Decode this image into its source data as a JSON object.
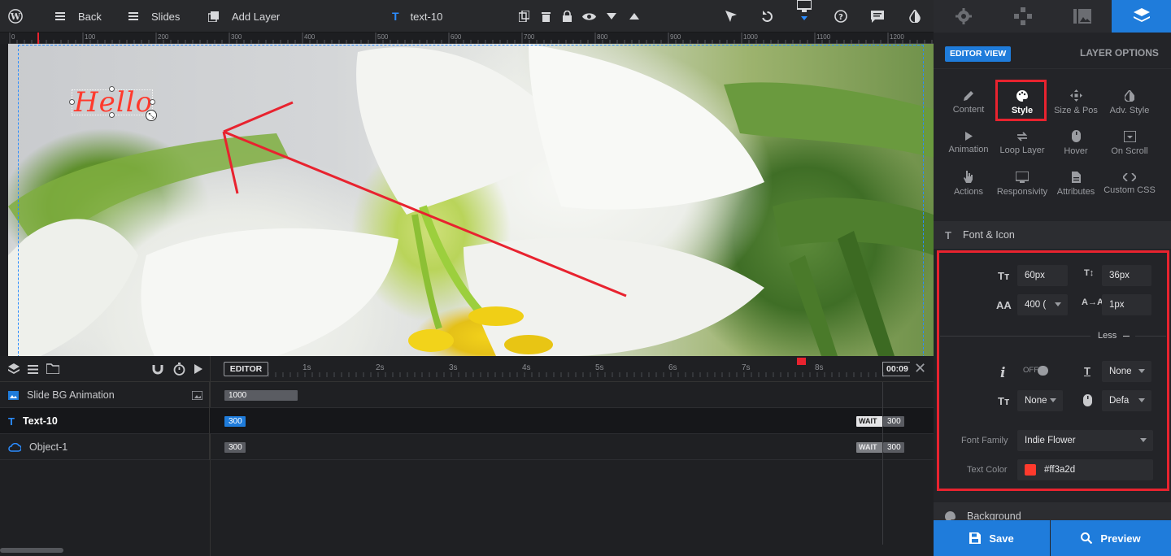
{
  "topbar": {
    "back": "Back",
    "slides": "Slides",
    "add_layer": "Add Layer",
    "layer_name": "text-10"
  },
  "ruler": {
    "marks": [
      "0",
      "100",
      "200",
      "300",
      "400",
      "500",
      "600",
      "700",
      "800",
      "900",
      "1000",
      "1100",
      "1200"
    ]
  },
  "canvas": {
    "text_layer": "Hello",
    "text_color": "#ff3a2d"
  },
  "timeline": {
    "editor_label": "EDITOR",
    "time_marks": [
      "1s",
      "2s",
      "3s",
      "4s",
      "5s",
      "6s",
      "7s",
      "8s"
    ],
    "current_time": "00:09",
    "rows": [
      {
        "name": "Slide BG Animation",
        "bar": "1000"
      },
      {
        "name": "Text-10",
        "bar": "300",
        "wait": "WAIT",
        "wait_val": "300"
      },
      {
        "name": "Object-1",
        "bar": "300",
        "wait": "WAIT",
        "wait_val": "300"
      }
    ]
  },
  "panel": {
    "editor_view": "EDITOR VIEW",
    "layer_options": "LAYER OPTIONS",
    "buttons": [
      {
        "label": "Content",
        "icon": "pencil-icon"
      },
      {
        "label": "Style",
        "icon": "palette-icon"
      },
      {
        "label": "Size & Pos",
        "icon": "move-icon"
      },
      {
        "label": "Adv. Style",
        "icon": "contrast-icon"
      },
      {
        "label": "Animation",
        "icon": "play-icon"
      },
      {
        "label": "Loop Layer",
        "icon": "loop-icon"
      },
      {
        "label": "Hover",
        "icon": "mouse-icon"
      },
      {
        "label": "On Scroll",
        "icon": "scroll-icon"
      },
      {
        "label": "Actions",
        "icon": "hand-icon"
      },
      {
        "label": "Responsivity",
        "icon": "responsive-icon"
      },
      {
        "label": "Attributes",
        "icon": "file-icon"
      },
      {
        "label": "Custom CSS",
        "icon": "code-icon"
      }
    ],
    "font_section": "Font & Icon",
    "font_size": "60px",
    "line_height": "36px",
    "font_weight": "400 (",
    "letter_spacing": "1px",
    "less": "Less",
    "italic_toggle": "OFF",
    "text_transform": "None",
    "text_decoration": "None",
    "cursor": "Defa",
    "font_family_label": "Font Family",
    "font_family": "Indie Flower",
    "text_color_label": "Text Color",
    "text_color": "#ff3a2d",
    "background_section": "Background",
    "save": "Save",
    "preview": "Preview"
  },
  "colors": {
    "accent": "#1f7cdb",
    "highlight": "#e8232f"
  }
}
